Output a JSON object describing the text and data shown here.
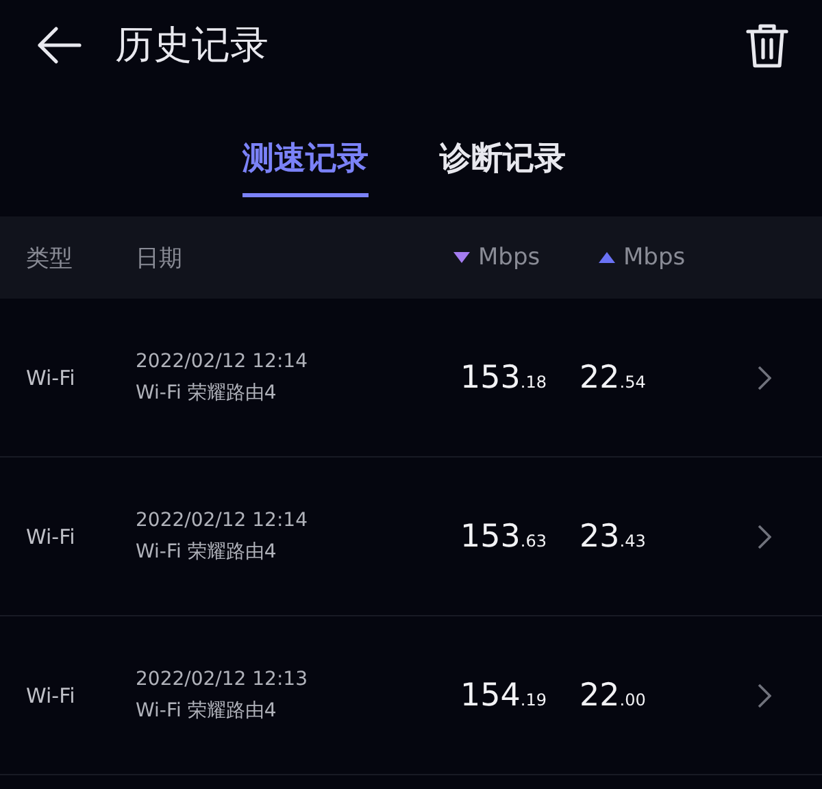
{
  "header": {
    "title": "历史记录"
  },
  "tabs": [
    {
      "label": "测速记录",
      "selected": true
    },
    {
      "label": "诊断记录",
      "selected": false
    }
  ],
  "table": {
    "columns": [
      {
        "label": "类型"
      },
      {
        "label": "日期"
      },
      {
        "label": "Mbps",
        "kind": "down"
      },
      {
        "label": "Mbps",
        "kind": "up"
      }
    ],
    "rows": [
      {
        "type": "Wi-Fi",
        "date": "2022/02/12 12:14",
        "network": "Wi-Fi 荣耀路由4",
        "down_int": "153",
        "down_dec": ".18",
        "up_int": "22",
        "up_dec": ".54"
      },
      {
        "type": "Wi-Fi",
        "date": "2022/02/12 12:14",
        "network": "Wi-Fi 荣耀路由4",
        "down_int": "153",
        "down_dec": ".63",
        "up_int": "23",
        "up_dec": ".43"
      },
      {
        "type": "Wi-Fi",
        "date": "2022/02/12 12:13",
        "network": "Wi-Fi 荣耀路由4",
        "down_int": "154",
        "down_dec": ".19",
        "up_int": "22",
        "up_dec": ".00"
      }
    ]
  }
}
